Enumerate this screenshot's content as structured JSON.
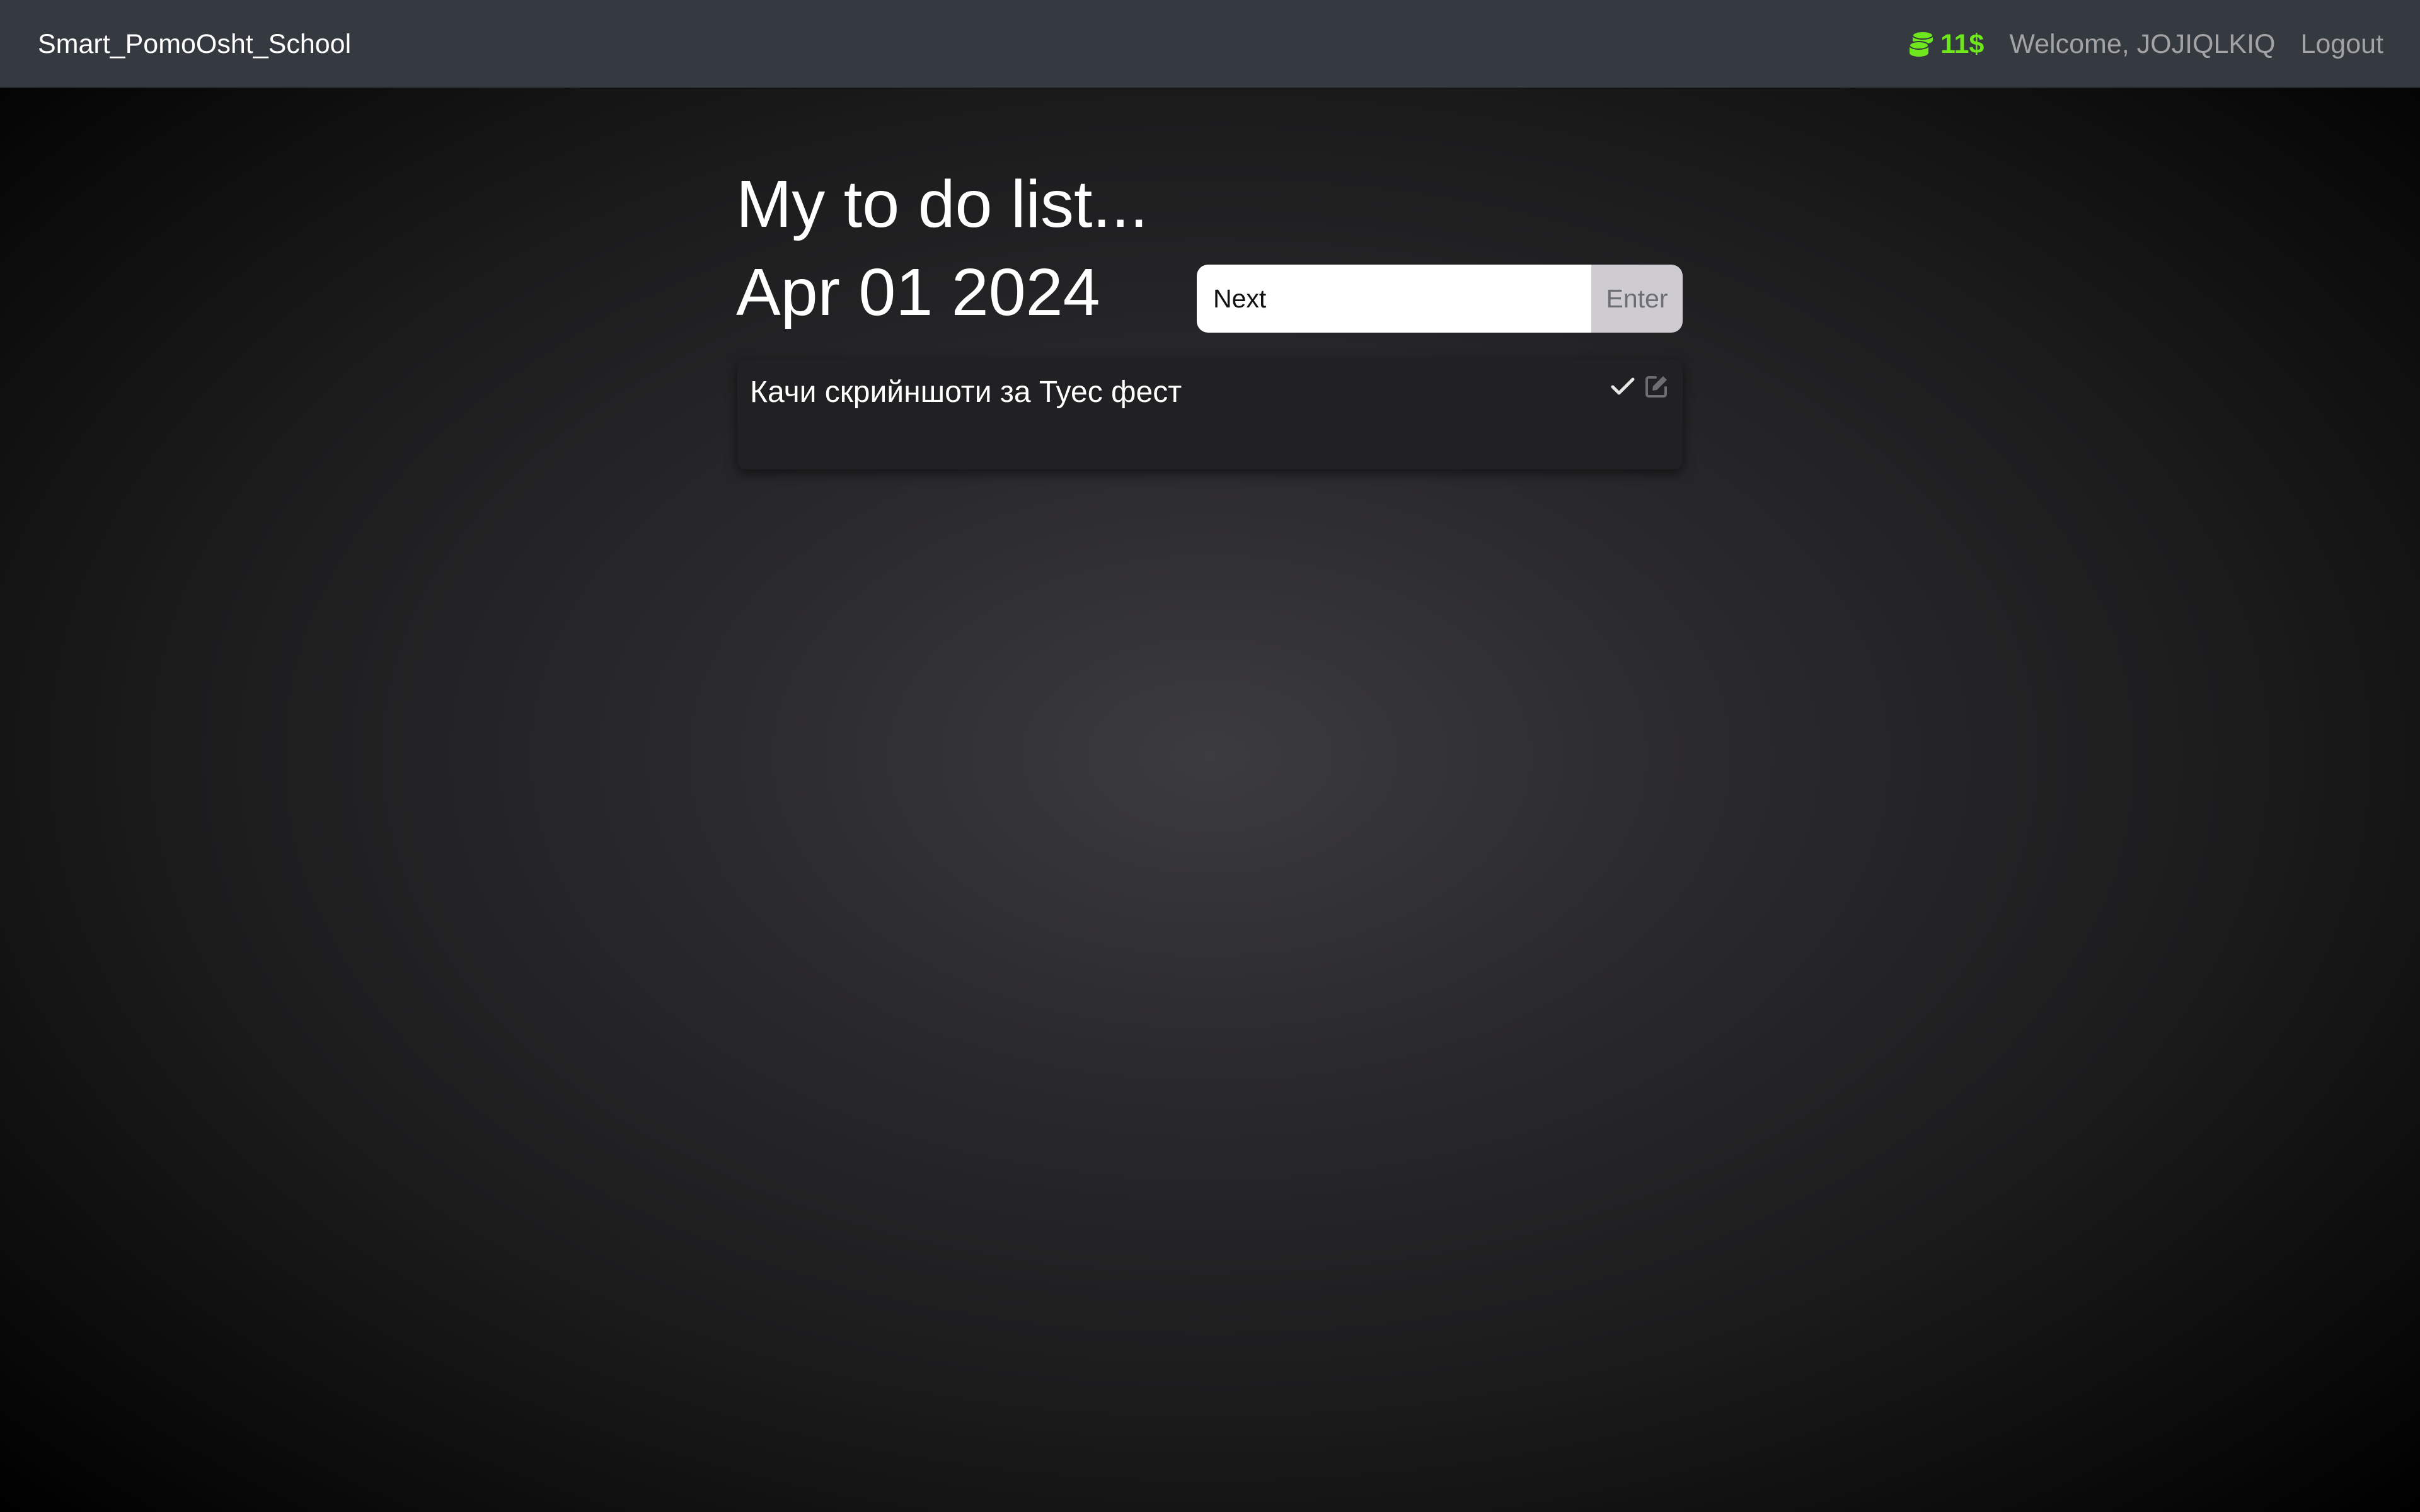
{
  "navbar": {
    "brand": "Smart_PomoOsht_School",
    "coins": "11$",
    "coins_color": "#6ee71c",
    "coins_icon": "coins-icon",
    "welcome": "Welcome, JOJIQLKIQ",
    "logout": "Logout"
  },
  "main": {
    "title": "My to do list...",
    "date": "Apr 01 2024",
    "input": {
      "value": "Next",
      "button_label": "Enter"
    },
    "tasks": [
      {
        "text": "Качи скрийншоти за Туес фест",
        "actions": [
          "check-icon",
          "edit-icon"
        ]
      }
    ]
  }
}
